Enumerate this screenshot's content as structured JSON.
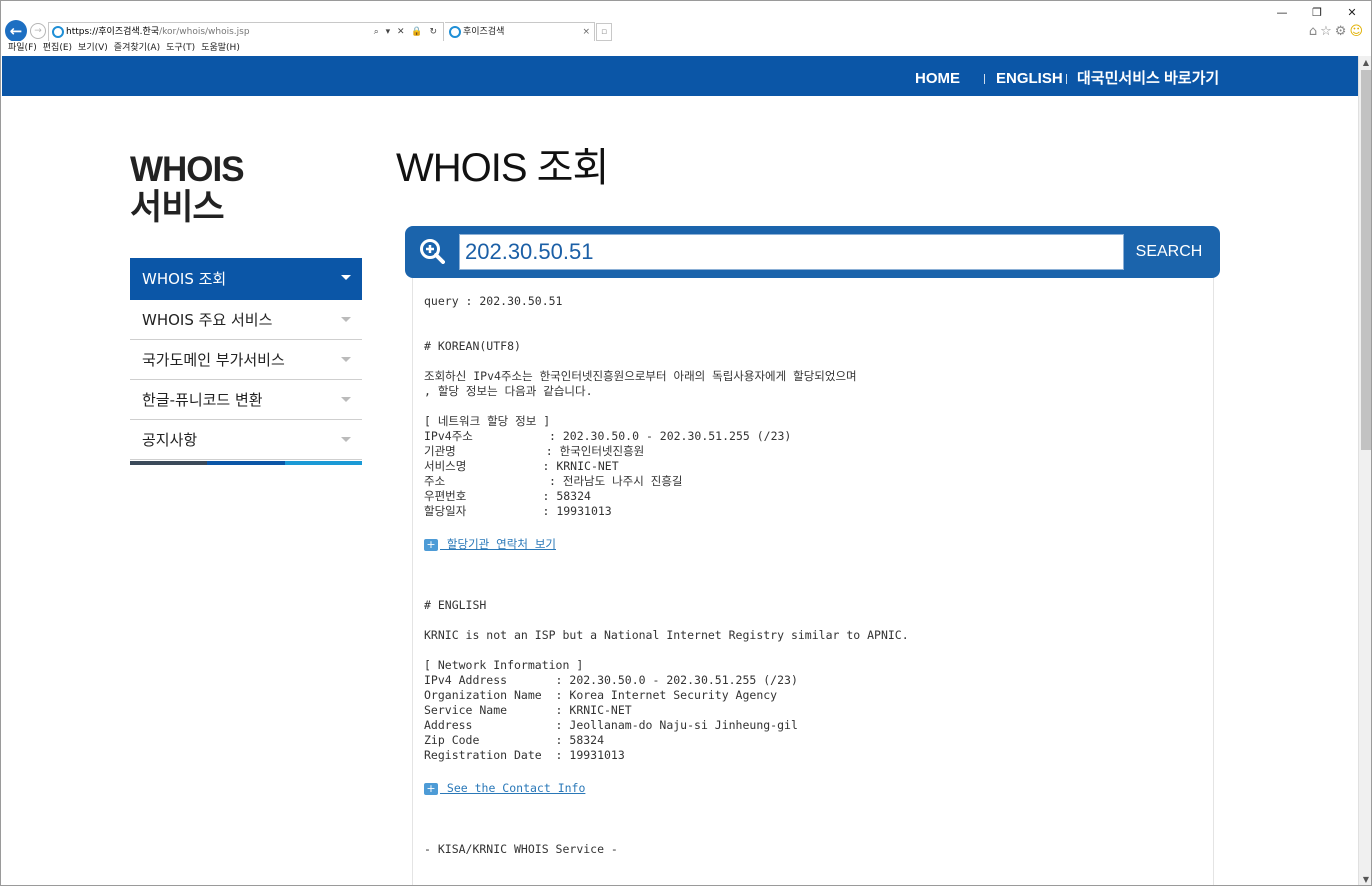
{
  "browser": {
    "url_host": "https://후이즈검색.한국",
    "url_path": "/kor/whois/whois.jsp",
    "tab_title": "후이즈검색",
    "menus": [
      "파일(F)",
      "편집(E)",
      "보기(V)",
      "즐겨찾기(A)",
      "도구(T)",
      "도움말(H)"
    ]
  },
  "topnav": {
    "home": "HOME",
    "english": "ENGLISH",
    "civil": "대국민서비스 바로가기"
  },
  "sidebar": {
    "title_line1": "WHOIS",
    "title_line2": "서비스",
    "items": [
      {
        "label": "WHOIS 조회",
        "active": true
      },
      {
        "label": "WHOIS 주요 서비스",
        "active": false
      },
      {
        "label": "국가도메인 부가서비스",
        "active": false
      },
      {
        "label": "한글-퓨니코드 변환",
        "active": false
      },
      {
        "label": "공지사항",
        "active": false
      }
    ],
    "bar_colors": [
      "#3b4a5a",
      "#0b56a7",
      "#1b9ad6"
    ]
  },
  "main": {
    "title": "WHOIS 조회",
    "search_value": "202.30.50.51",
    "search_button": "SEARCH"
  },
  "result": {
    "query": "query : 202.30.50.51",
    "korean_header": "# KOREAN(UTF8)",
    "korean_intro1": "조회하신 IPv4주소는 한국인터넷진흥원으로부터 아래의 독립사용자에게 할당되었으며",
    "korean_intro2": ", 할당 정보는 다음과 같습니다.",
    "korean_section": "[ 네트워크 할당 정보 ]",
    "korean_rows": [
      "IPv4주소           : 202.30.50.0 - 202.30.51.255 (/23)",
      "기관명             : 한국인터넷진흥원",
      "서비스명           : KRNIC-NET",
      "주소               : 전라남도 나주시 진흥길",
      "우편번호           : 58324",
      "할당일자           : 19931013"
    ],
    "korean_link": " 할당기관 연락처 보기",
    "english_header": "# ENGLISH",
    "english_intro": "KRNIC is not an ISP but a National Internet Registry similar to APNIC.",
    "english_section": "[ Network Information ]",
    "english_rows": [
      "IPv4 Address       : 202.30.50.0 - 202.30.51.255 (/23)",
      "Organization Name  : Korea Internet Security Agency",
      "Service Name       : KRNIC-NET",
      "Address            : Jeollanam-do Naju-si Jinheung-gil",
      "Zip Code           : 58324",
      "Registration Date  : 19931013"
    ],
    "english_link": " See the Contact Info",
    "footer": "- KISA/KRNIC WHOIS Service -"
  },
  "colors": {
    "brand_blue": "#0b56a7",
    "search_blue": "#1b64ac",
    "link_blue": "#2a78b8"
  }
}
